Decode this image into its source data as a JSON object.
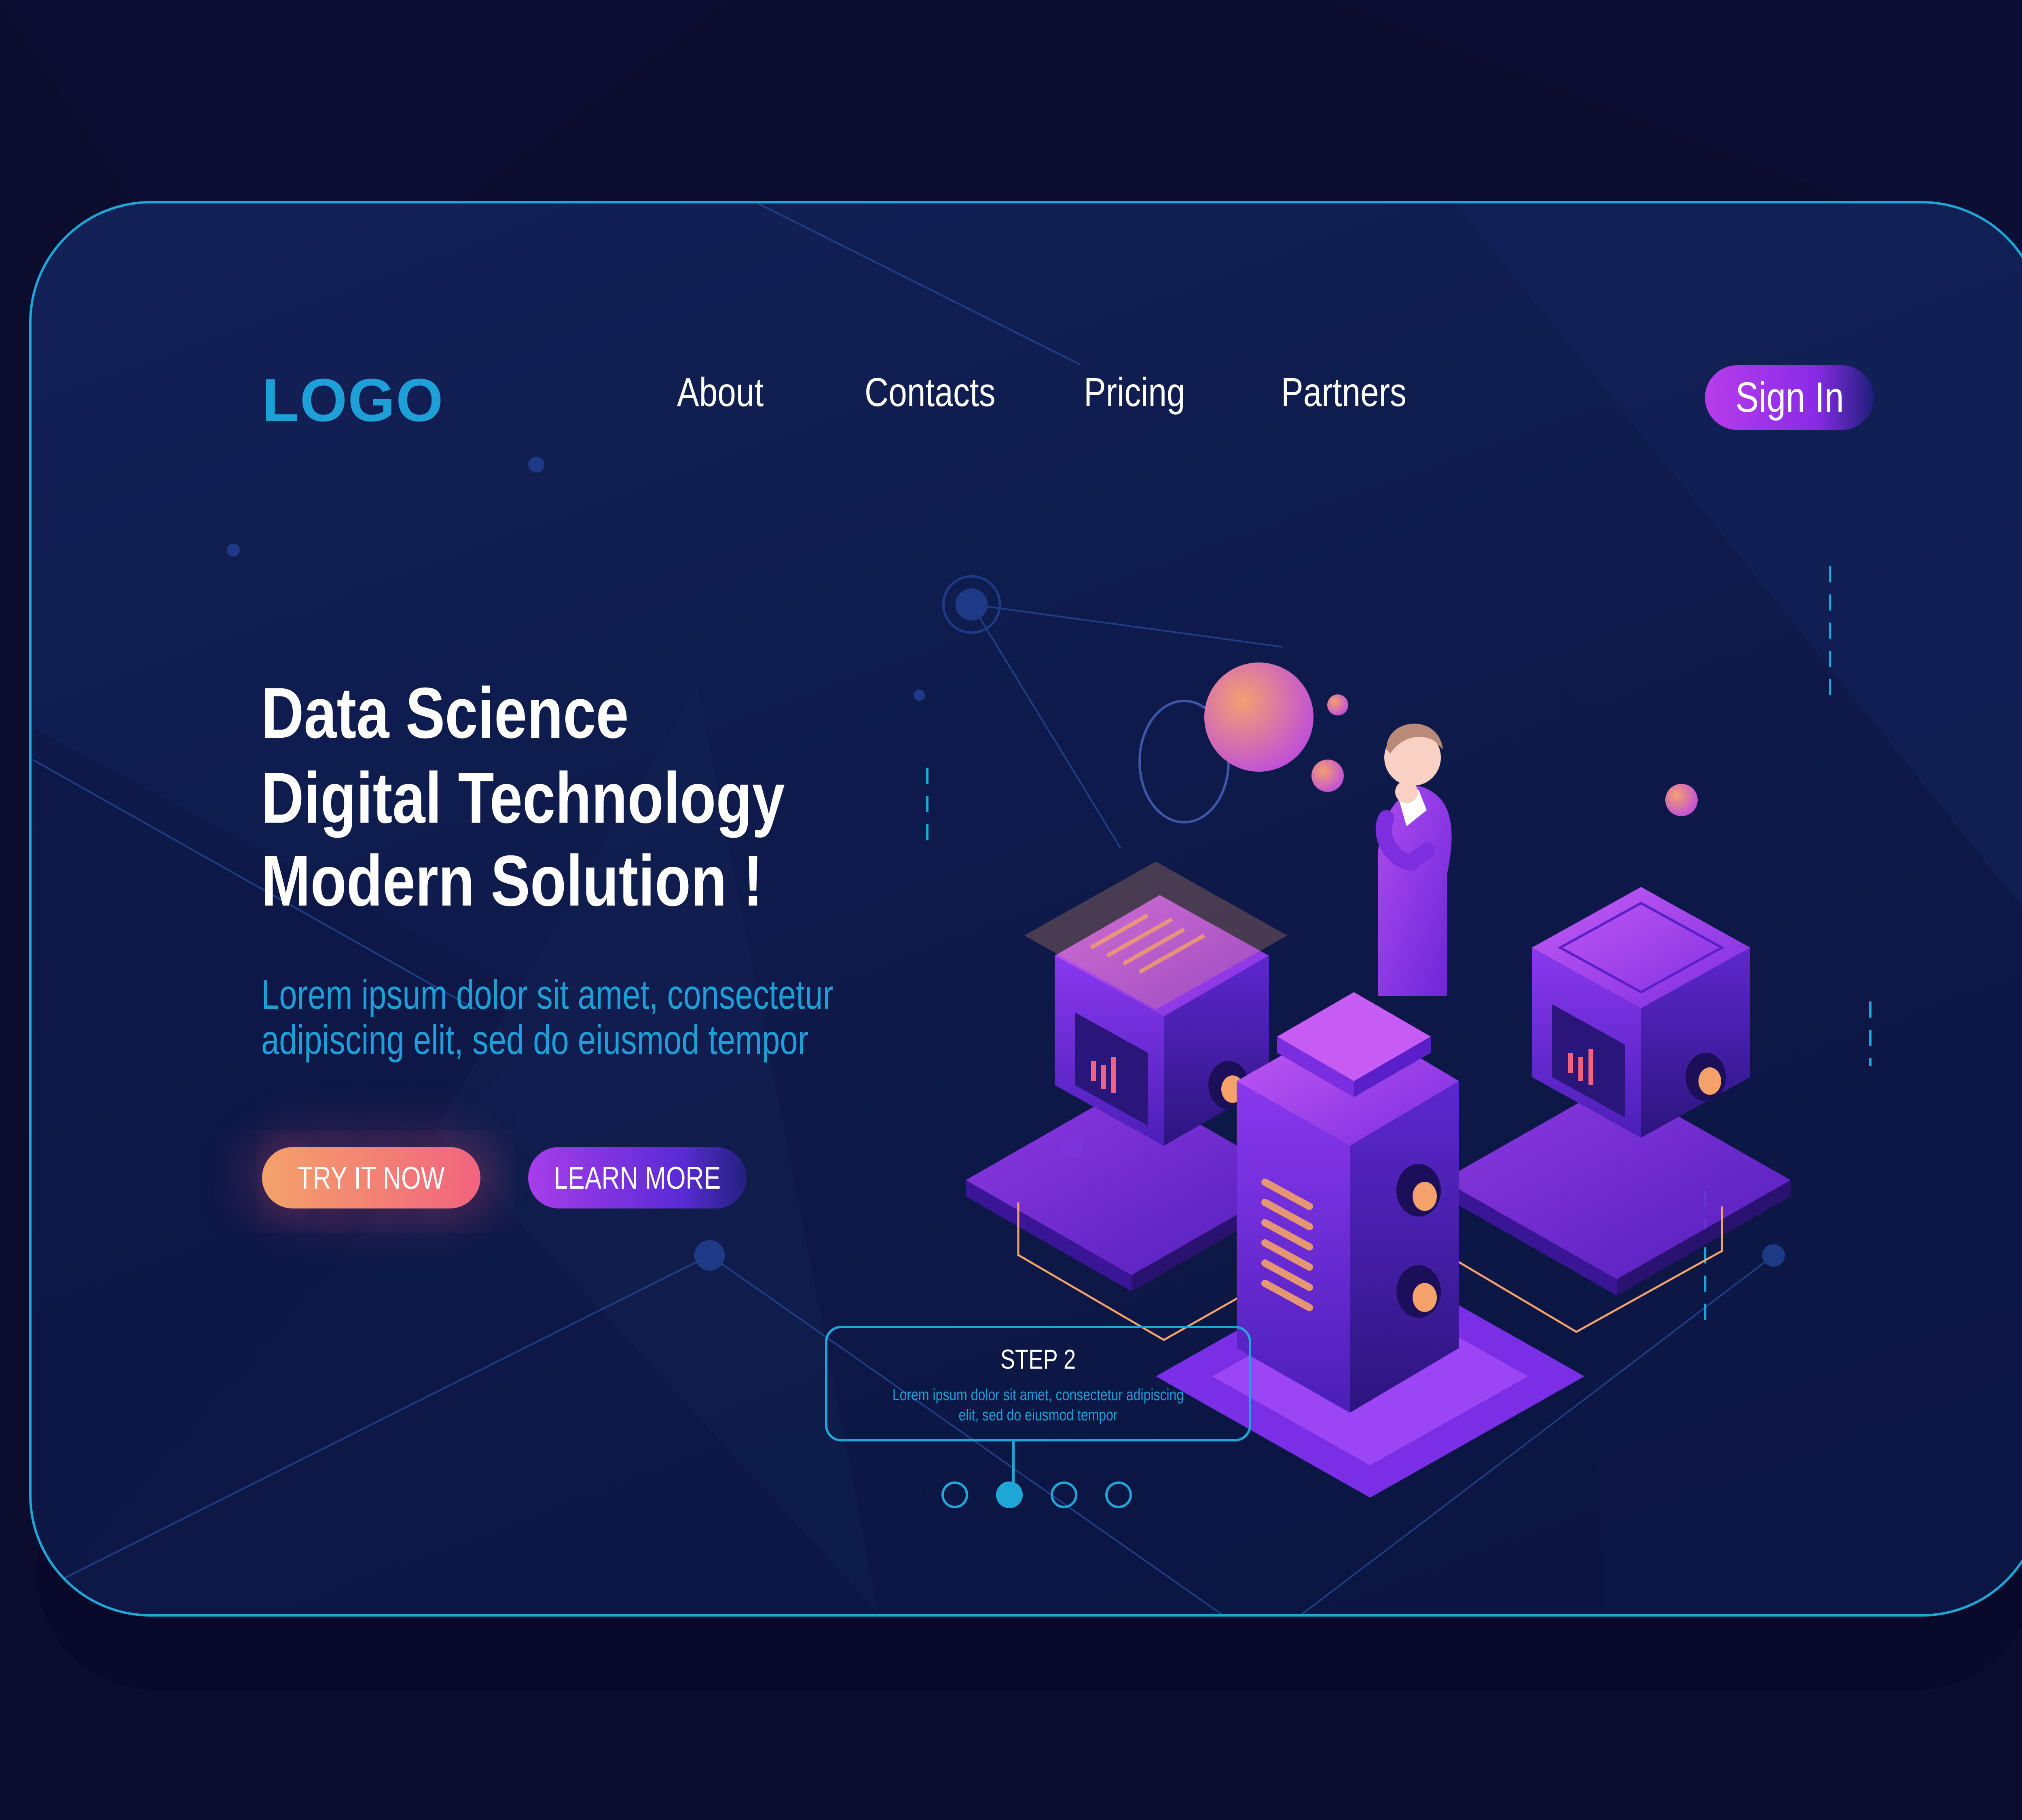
{
  "header": {
    "logo": "LOGO",
    "nav": [
      {
        "label": "About"
      },
      {
        "label": "Contacts"
      },
      {
        "label": "Pricing"
      },
      {
        "label": "Partners"
      }
    ],
    "sign_in": "Sign In"
  },
  "hero": {
    "headline": [
      "Data Science",
      "Digital Technology",
      "Modern Solution !"
    ],
    "lead": [
      "Lorem ipsum dolor sit amet, consectetur",
      "adipiscing elit, sed do eiusmod tempor"
    ],
    "cta_primary": "TRY IT NOW",
    "cta_secondary": "LEARN MORE"
  },
  "step": {
    "title": "STEP 2",
    "description": "Lorem ipsum dolor sit amet, consectetur adipiscing elit, sed do eiusmod tempor"
  },
  "pagination": {
    "total": 4,
    "active_index": 1
  },
  "colors": {
    "background": "#0b0c2e",
    "accent_blue": "#1d9fd8",
    "accent_purple": "#8a2be8",
    "accent_orange": "#f4a26a",
    "accent_pink": "#f2637e"
  },
  "icons": {
    "illustration": "isometric-server-person-illustration"
  }
}
